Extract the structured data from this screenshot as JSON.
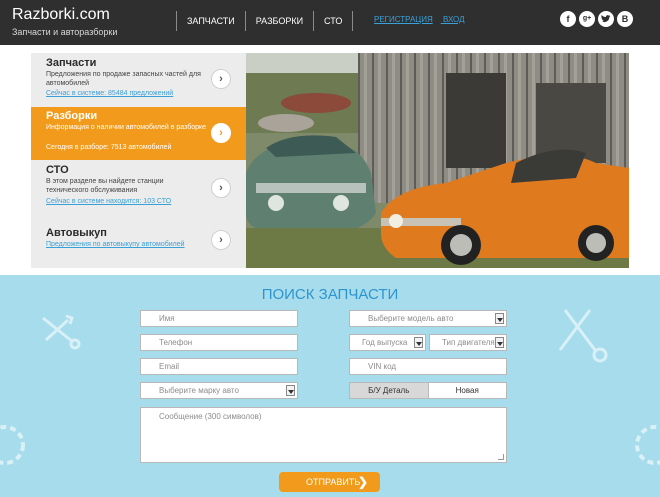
{
  "header": {
    "logo": "Razborki.com",
    "tagline": "Запчасти и авторазборки",
    "nav": [
      "ЗАПЧАСТИ",
      "РАЗБОРКИ",
      "СТО"
    ],
    "register": "РЕГИСТРАЦИЯ",
    "login": "ВХОД",
    "socials": [
      "f",
      "g+",
      "t",
      "B"
    ]
  },
  "menu": [
    {
      "title": "Запчасти",
      "desc": "Предложения по продаже запасных частей для автомобилей",
      "link": "Сейчас в системе: 85484 предложений"
    },
    {
      "title": "Разборки",
      "desc": "Информация о наличии автомобилей в разборке",
      "link": "Сегодня в разборе: 7513 автомобилей"
    },
    {
      "title": "СТО",
      "desc": "В этом разделе вы найдете станции технического обслуживания",
      "link": "Сейчас в системе находится: 103 СТО"
    },
    {
      "title": "Автовыкуп",
      "desc": "",
      "link": "Предложения по автовыкупу автомобилей"
    }
  ],
  "search": {
    "title": "ПОИСК ЗАПЧАСТИ",
    "name": "Имя",
    "phone": "Телефон",
    "email": "Email",
    "brand": "Выберите марку авто",
    "model": "Выберите модель авто",
    "year": "Год выпуска",
    "engine": "Тип двигателя",
    "vin": "VIN код",
    "used": "Б/У Деталь",
    "new": "Новая",
    "message": "Сообщение (300 символов)",
    "submit": "ОТПРАВИТЬ"
  },
  "colors": {
    "accent": "#f29a1b",
    "header": "#2f2f2f",
    "search_bg": "#a6dcec",
    "title": "#2f95d0"
  }
}
